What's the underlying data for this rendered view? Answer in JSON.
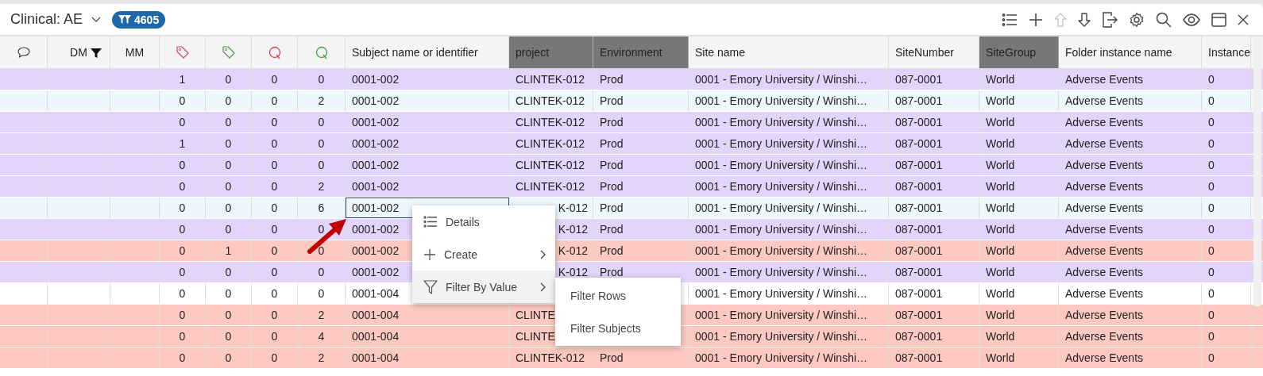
{
  "view": {
    "title": "Clinical: AE",
    "filter_count": "4605"
  },
  "toolbar": [
    {
      "kind": "list",
      "disabled": false
    },
    {
      "kind": "add",
      "disabled": false
    },
    {
      "kind": "up",
      "disabled": true
    },
    {
      "kind": "down",
      "disabled": false
    },
    {
      "kind": "export",
      "disabled": false
    },
    {
      "kind": "settings",
      "disabled": false
    },
    {
      "kind": "search",
      "disabled": false
    },
    {
      "kind": "view",
      "disabled": false
    },
    {
      "kind": "panel",
      "disabled": false
    },
    {
      "kind": "close",
      "disabled": false
    }
  ],
  "columns": [
    {
      "kind": "comment",
      "highlighted": false
    },
    {
      "kind": "text",
      "label": "DM",
      "highlighted": false,
      "filtered": true
    },
    {
      "kind": "text",
      "label": "MM",
      "highlighted": false,
      "filtered": false
    },
    {
      "kind": "tag",
      "color": "#d0457a",
      "highlighted": false
    },
    {
      "kind": "tag",
      "color": "#4c9a4c",
      "highlighted": false
    },
    {
      "kind": "query",
      "color": "#c9474f",
      "highlighted": false
    },
    {
      "kind": "query",
      "color": "#4c9a4c",
      "highlighted": false
    },
    {
      "kind": "text",
      "label": "Subject name or identifier",
      "highlighted": false,
      "filtered": false
    },
    {
      "kind": "text",
      "label": "project",
      "highlighted": true,
      "filtered": false
    },
    {
      "kind": "text",
      "label": "Environment",
      "highlighted": true,
      "filtered": false
    },
    {
      "kind": "text",
      "label": "Site name",
      "highlighted": false,
      "filtered": false
    },
    {
      "kind": "text",
      "label": "SiteNumber",
      "highlighted": false,
      "filtered": false
    },
    {
      "kind": "text",
      "label": "SiteGroup",
      "highlighted": true,
      "filtered": false
    },
    {
      "kind": "text",
      "label": "Folder instance name",
      "highlighted": false,
      "filtered": false
    },
    {
      "kind": "text",
      "label": "Instance",
      "highlighted": false,
      "filtered": false
    }
  ],
  "rows": [
    {
      "color": "#e2d4fb",
      "focused": false,
      "cells": [
        "1",
        "0",
        "0",
        "0",
        "0001-002",
        "CLINTEK-012",
        "Prod",
        "0001 - Emory University / Winshi…",
        "087-0001",
        "World",
        "Adverse Events",
        "0"
      ]
    },
    {
      "color": "#eef7fc",
      "focused": false,
      "cells": [
        "0",
        "0",
        "0",
        "2",
        "0001-002",
        "CLINTEK-012",
        "Prod",
        "0001 - Emory University / Winshi…",
        "087-0001",
        "World",
        "Adverse Events",
        "0"
      ]
    },
    {
      "color": "#e2d4fb",
      "focused": false,
      "cells": [
        "0",
        "0",
        "0",
        "0",
        "0001-002",
        "CLINTEK-012",
        "Prod",
        "0001 - Emory University / Winshi…",
        "087-0001",
        "World",
        "Adverse Events",
        "0"
      ]
    },
    {
      "color": "#e2d4fb",
      "focused": false,
      "cells": [
        "1",
        "0",
        "0",
        "0",
        "0001-002",
        "CLINTEK-012",
        "Prod",
        "0001 - Emory University / Winshi…",
        "087-0001",
        "World",
        "Adverse Events",
        "0"
      ]
    },
    {
      "color": "#e2d4fb",
      "focused": false,
      "cells": [
        "0",
        "0",
        "0",
        "0",
        "0001-002",
        "CLINTEK-012",
        "Prod",
        "0001 - Emory University / Winshi…",
        "087-0001",
        "World",
        "Adverse Events",
        "0"
      ]
    },
    {
      "color": "#e2d4fb",
      "focused": false,
      "cells": [
        "0",
        "0",
        "0",
        "2",
        "0001-002",
        "CLINTEK-012",
        "Prod",
        "0001 - Emory University / Winshi…",
        "087-0001",
        "World",
        "Adverse Events",
        "0"
      ]
    },
    {
      "color": "#eef7fc",
      "focused": true,
      "cells": [
        "0",
        "0",
        "0",
        "6",
        "0001-002",
        {
          "text": "K-012",
          "covered_left": true
        },
        "Prod",
        "0001 - Emory University / Winshi…",
        "087-0001",
        "World",
        "Adverse Events",
        "0"
      ]
    },
    {
      "color": "#e2d4fb",
      "focused": false,
      "cells": [
        "0",
        "0",
        "0",
        "0",
        "0001-002",
        {
          "text": "K-012",
          "covered_left": true
        },
        "Prod",
        "0001 - Emory University / Winshi…",
        "087-0001",
        "World",
        "Adverse Events",
        "0"
      ]
    },
    {
      "color": "#fdc9c0",
      "focused": false,
      "cells": [
        "0",
        "1",
        "0",
        "0",
        "0001-002",
        {
          "text": "K-012",
          "covered_left": true
        },
        "Prod",
        "0001 - Emory University / Winshi…",
        "087-0001",
        "World",
        "Adverse Events",
        "0"
      ]
    },
    {
      "color": "#e2d4fb",
      "focused": false,
      "cells": [
        "0",
        "0",
        "0",
        "0",
        "0001-002",
        {
          "text": "K-012",
          "covered_left": true
        },
        "Prod",
        "0001 - Emory University / Winshi…",
        "087-0001",
        "World",
        "Adverse Events",
        "0"
      ]
    },
    {
      "color": "#ffffff",
      "focused": false,
      "cells": [
        "0",
        "0",
        "0",
        "0",
        "0001-004",
        null,
        null,
        "0001 - Emory University / Winshi…",
        "087-0001",
        "World",
        "Adverse Events",
        "0"
      ]
    },
    {
      "color": "#fdc9c0",
      "focused": false,
      "cells": [
        "0",
        "0",
        "0",
        "2",
        "0001-004",
        "CLINTE",
        null,
        "0001 - Emory University / Winshi…",
        "087-0001",
        "World",
        "Adverse Events",
        "0"
      ]
    },
    {
      "color": "#fdc9c0",
      "focused": false,
      "cells": [
        "0",
        "0",
        "0",
        "4",
        "0001-004",
        "CLINTE",
        null,
        "0001 - Emory University / Winshi…",
        "087-0001",
        "World",
        "Adverse Events",
        "0"
      ]
    },
    {
      "color": "#fdc9c0",
      "focused": false,
      "cells": [
        "0",
        "0",
        "0",
        "2",
        "0001-004",
        "CLINTEK-012",
        "Prod",
        "0001 - Emory University / Winshi…",
        "087-0001",
        "World",
        "Adverse Events",
        "0"
      ]
    }
  ],
  "context_menu": {
    "items": [
      {
        "kind": "details",
        "label": "Details",
        "submenu": false,
        "highlighted": false
      },
      {
        "kind": "create",
        "label": "Create",
        "submenu": true,
        "highlighted": false
      },
      {
        "kind": "filter",
        "label": "Filter By Value",
        "submenu": true,
        "highlighted": true
      }
    ],
    "submenu": [
      "Filter Rows",
      "Filter Subjects"
    ]
  }
}
